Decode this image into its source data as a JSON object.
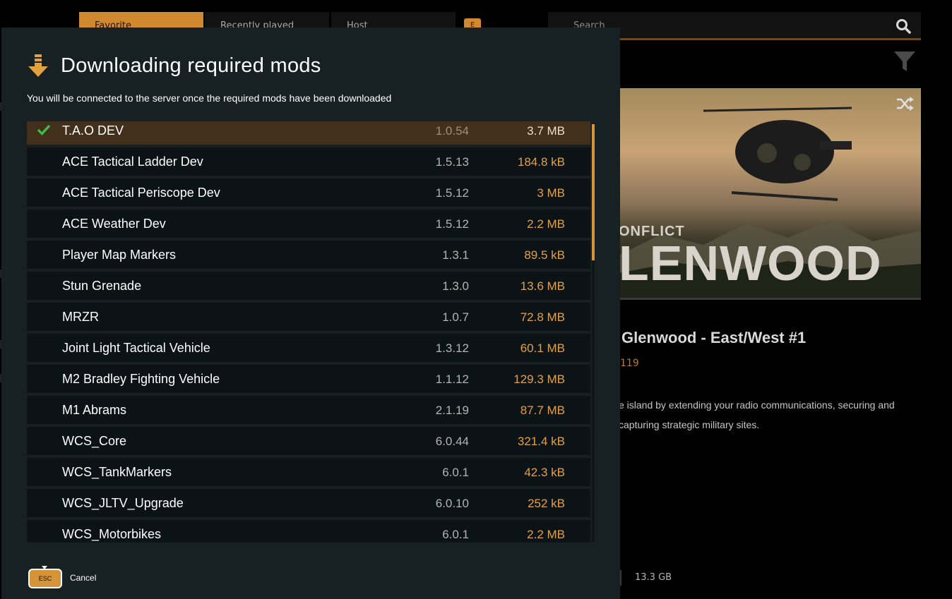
{
  "background": {
    "tabs": [
      "Favorite",
      "Recently played",
      "Host"
    ],
    "tab_key": "E",
    "search_placeholder": "Search",
    "hero_subtitle": "ONFLICT",
    "hero_title": "LENWOOD",
    "server_title": "Glenwood - East/West #1",
    "server_number": "119",
    "description": "e island by extending your radio communications, securing and capturing strategic military sites.",
    "size": "13.3 GB"
  },
  "modal": {
    "title": "Downloading required mods",
    "subtitle": "You will be connected to the server once the required mods have been downloaded",
    "mods": [
      {
        "name": "T.A.O DEV",
        "version": "1.0.54",
        "size": "3.7 MB",
        "done": true
      },
      {
        "name": "ACE Tactical Ladder Dev",
        "version": "1.5.13",
        "size": "184.8 kB",
        "done": false
      },
      {
        "name": "ACE Tactical Periscope Dev",
        "version": "1.5.12",
        "size": "3 MB",
        "done": false
      },
      {
        "name": "ACE Weather Dev",
        "version": "1.5.12",
        "size": "2.2 MB",
        "done": false
      },
      {
        "name": "Player Map Markers",
        "version": "1.3.1",
        "size": "89.5 kB",
        "done": false
      },
      {
        "name": "Stun Grenade",
        "version": "1.3.0",
        "size": "13.6 MB",
        "done": false
      },
      {
        "name": "MRZR",
        "version": "1.0.7",
        "size": "72.8 MB",
        "done": false
      },
      {
        "name": "Joint Light Tactical Vehicle",
        "version": "1.3.12",
        "size": "60.1 MB",
        "done": false
      },
      {
        "name": "M2 Bradley Fighting Vehicle",
        "version": "1.1.12",
        "size": "129.3 MB",
        "done": false
      },
      {
        "name": "M1 Abrams",
        "version": "2.1.19",
        "size": "87.7 MB",
        "done": false
      },
      {
        "name": "WCS_Core",
        "version": "6.0.44",
        "size": "321.4 kB",
        "done": false
      },
      {
        "name": "WCS_TankMarkers",
        "version": "6.0.1",
        "size": "42.3 kB",
        "done": false
      },
      {
        "name": "WCS_JLTV_Upgrade",
        "version": "6.0.10",
        "size": "252 kB",
        "done": false
      },
      {
        "name": "WCS_Motorbikes",
        "version": "6.0.1",
        "size": "2.2 MB",
        "done": false
      }
    ],
    "esc_key": "ESC",
    "cancel_label": "Cancel"
  },
  "colors": {
    "accent": "#d69438",
    "modal_bg": "#172023",
    "row_bg": "#0b1316",
    "active_row_bg": "#42301c",
    "size_text": "#e0a14b",
    "check_green": "#3fbf4f"
  }
}
